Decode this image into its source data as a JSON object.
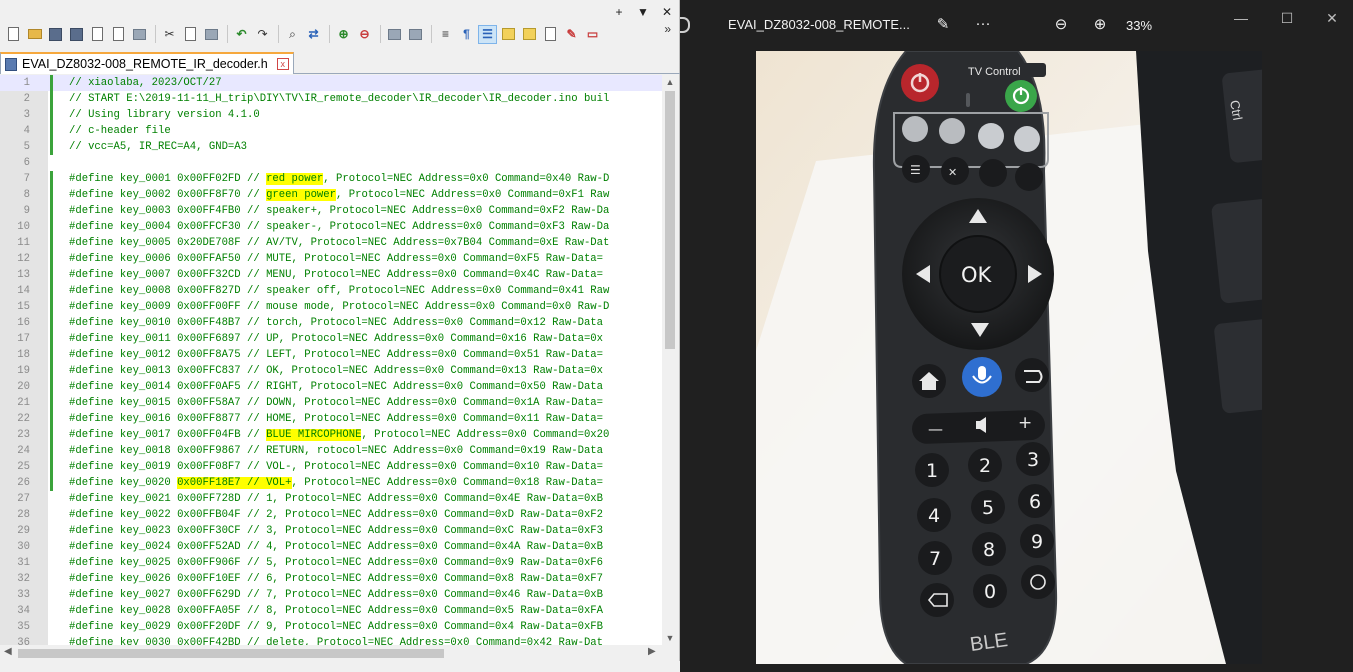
{
  "editor": {
    "window_controls": [
      "+",
      "▼",
      "✕"
    ],
    "toolbar_more": "»",
    "tab": {
      "title": "EVAI_DZ8032-008_REMOTE_IR_decoder.h",
      "close": "x"
    },
    "current_line": 1,
    "lines": [
      {
        "n": 1,
        "pre": "// xiaolaba, 2023/OCT/27",
        "hl": "",
        "post": "",
        "mark": true
      },
      {
        "n": 2,
        "pre": "// START E:\\2019-11-11_H_trip\\DIY\\TV\\IR_remote_decoder\\IR_decoder\\IR_decoder.ino buil",
        "hl": "",
        "post": "",
        "mark": true
      },
      {
        "n": 3,
        "pre": "// Using library version 4.1.0",
        "hl": "",
        "post": "",
        "mark": true
      },
      {
        "n": 4,
        "pre": "// c-header file",
        "hl": "",
        "post": "",
        "mark": true
      },
      {
        "n": 5,
        "pre": "// vcc=A5, IR_REC=A4, GND=A3",
        "hl": "",
        "post": "",
        "mark": true
      },
      {
        "n": 6,
        "pre": "",
        "hl": "",
        "post": "",
        "mark": false
      },
      {
        "n": 7,
        "pre": "#define key_0001 0x00FF02FD // ",
        "hl": "red power",
        "post": ", Protocol=NEC Address=0x0 Command=0x40 Raw-D",
        "mark": true
      },
      {
        "n": 8,
        "pre": "#define key_0002 0x00FF8F70 // ",
        "hl": "green power",
        "post": ", Protocol=NEC Address=0x0 Command=0xF1 Raw",
        "mark": true
      },
      {
        "n": 9,
        "pre": "#define key_0003 0x00FF4FB0 // speaker+, Protocol=NEC Address=0x0 Command=0xF2 Raw-Da",
        "hl": "",
        "post": "",
        "mark": true
      },
      {
        "n": 10,
        "pre": "#define key_0004 0x00FFCF30 // speaker-, Protocol=NEC Address=0x0 Command=0xF3 Raw-Da",
        "hl": "",
        "post": "",
        "mark": true
      },
      {
        "n": 11,
        "pre": "#define key_0005 0x20DE708F // AV/TV, Protocol=NEC Address=0x7B04 Command=0xE Raw-Dat",
        "hl": "",
        "post": "",
        "mark": true
      },
      {
        "n": 12,
        "pre": "#define key_0006 0x00FFAF50 // MUTE, Protocol=NEC Address=0x0 Command=0xF5 Raw-Data=",
        "hl": "",
        "post": "",
        "mark": true
      },
      {
        "n": 13,
        "pre": "#define key_0007 0x00FF32CD // MENU, Protocol=NEC Address=0x0 Command=0x4C Raw-Data=",
        "hl": "",
        "post": "",
        "mark": true
      },
      {
        "n": 14,
        "pre": "#define key_0008 0x00FF827D // speaker off, Protocol=NEC Address=0x0 Command=0x41 Raw",
        "hl": "",
        "post": "",
        "mark": true
      },
      {
        "n": 15,
        "pre": "#define key_0009 0x00FF00FF // mouse mode, Protocol=NEC Address=0x0 Command=0x0 Raw-D",
        "hl": "",
        "post": "",
        "mark": true
      },
      {
        "n": 16,
        "pre": "#define key_0010 0x00FF48B7 // torch, Protocol=NEC Address=0x0 Command=0x12 Raw-Data",
        "hl": "",
        "post": "",
        "mark": true
      },
      {
        "n": 17,
        "pre": "#define key_0011 0x00FF6897 // UP, Protocol=NEC Address=0x0 Command=0x16 Raw-Data=0x",
        "hl": "",
        "post": "",
        "mark": true
      },
      {
        "n": 18,
        "pre": "#define key_0012 0x00FF8A75 // LEFT, Protocol=NEC Address=0x0 Command=0x51 Raw-Data=",
        "hl": "",
        "post": "",
        "mark": true
      },
      {
        "n": 19,
        "pre": "#define key_0013 0x00FFC837 // OK, Protocol=NEC Address=0x0 Command=0x13 Raw-Data=0x",
        "hl": "",
        "post": "",
        "mark": true
      },
      {
        "n": 20,
        "pre": "#define key_0014 0x00FF0AF5 // RIGHT, Protocol=NEC Address=0x0 Command=0x50 Raw-Data",
        "hl": "",
        "post": "",
        "mark": true
      },
      {
        "n": 21,
        "pre": "#define key_0015 0x00FF58A7 // DOWN, Protocol=NEC Address=0x0 Command=0x1A Raw-Data=",
        "hl": "",
        "post": "",
        "mark": true
      },
      {
        "n": 22,
        "pre": "#define key_0016 0x00FF8877 // HOME, Protocol=NEC Address=0x0 Command=0x11 Raw-Data=",
        "hl": "",
        "post": "",
        "mark": true
      },
      {
        "n": 23,
        "pre": "#define key_0017 0x00FF04FB // ",
        "hl": "BLUE MIRCOPHONE",
        "post": ", Protocol=NEC Address=0x0 Command=0x20",
        "mark": true
      },
      {
        "n": 24,
        "pre": "#define key_0018 0x00FF9867 // RETURN, rotocol=NEC Address=0x0 Command=0x19 Raw-Data",
        "hl": "",
        "post": "",
        "mark": true
      },
      {
        "n": 25,
        "pre": "#define key_0019 0x00FF08F7 // VOL-, Protocol=NEC Address=0x0 Command=0x10 Raw-Data=",
        "hl": "",
        "post": "",
        "mark": true
      },
      {
        "n": 26,
        "pre": "#define key_0020 ",
        "hl": "0x00FF18E7 // VOL+",
        "post": ", Protocol=NEC Address=0x0 Command=0x18 Raw-Data=",
        "mark": true
      },
      {
        "n": 27,
        "pre": "#define key_0021 0x00FF728D // 1, Protocol=NEC Address=0x0 Command=0x4E Raw-Data=0xB",
        "hl": "",
        "post": "",
        "mark": false
      },
      {
        "n": 28,
        "pre": "#define key_0022 0x00FFB04F // 2, Protocol=NEC Address=0x0 Command=0xD Raw-Data=0xF2",
        "hl": "",
        "post": "",
        "mark": false
      },
      {
        "n": 29,
        "pre": "#define key_0023 0x00FF30CF // 3, Protocol=NEC Address=0x0 Command=0xC Raw-Data=0xF3",
        "hl": "",
        "post": "",
        "mark": false
      },
      {
        "n": 30,
        "pre": "#define key_0024 0x00FF52AD // 4, Protocol=NEC Address=0x0 Command=0x4A Raw-Data=0xB",
        "hl": "",
        "post": "",
        "mark": false
      },
      {
        "n": 31,
        "pre": "#define key_0025 0x00FF906F // 5, Protocol=NEC Address=0x0 Command=0x9 Raw-Data=0xF6",
        "hl": "",
        "post": "",
        "mark": false
      },
      {
        "n": 32,
        "pre": "#define key_0026 0x00FF10EF // 6, Protocol=NEC Address=0x0 Command=0x8 Raw-Data=0xF7",
        "hl": "",
        "post": "",
        "mark": false
      },
      {
        "n": 33,
        "pre": "#define key_0027 0x00FF629D // 7, Protocol=NEC Address=0x0 Command=0x46 Raw-Data=0xB",
        "hl": "",
        "post": "",
        "mark": false
      },
      {
        "n": 34,
        "pre": "#define key_0028 0x00FFA05F // 8, Protocol=NEC Address=0x0 Command=0x5 Raw-Data=0xFA",
        "hl": "",
        "post": "",
        "mark": false
      },
      {
        "n": 35,
        "pre": "#define key_0029 0x00FF20DF // 9, Protocol=NEC Address=0x0 Command=0x4 Raw-Data=0xFB",
        "hl": "",
        "post": "",
        "mark": false
      },
      {
        "n": 36,
        "pre": "#define key_0030 0x00FF42BD // delete, Protocol=NEC Address=0x0 Command=0x42 Raw-Dat",
        "hl": "",
        "post": "",
        "mark": false
      }
    ]
  },
  "viewer": {
    "title": "EVAI_DZ8032-008_REMOTE...",
    "zoom": "33%",
    "more": "···",
    "window_controls": [
      "—",
      "☐",
      "✕"
    ],
    "remote": {
      "tv_control": "TV Control",
      "ok": "OK",
      "digits": [
        "1",
        "2",
        "3",
        "4",
        "5",
        "6",
        "7",
        "8",
        "9",
        "0"
      ],
      "minus": "—",
      "plus": "+",
      "brand": "BLE"
    }
  },
  "colors": {
    "highlight": "#ffff00",
    "comment_green": "#008000",
    "change_marker": "#3ba33b",
    "tab_accent": "#f6a83d",
    "viewer_bg": "#202020"
  }
}
